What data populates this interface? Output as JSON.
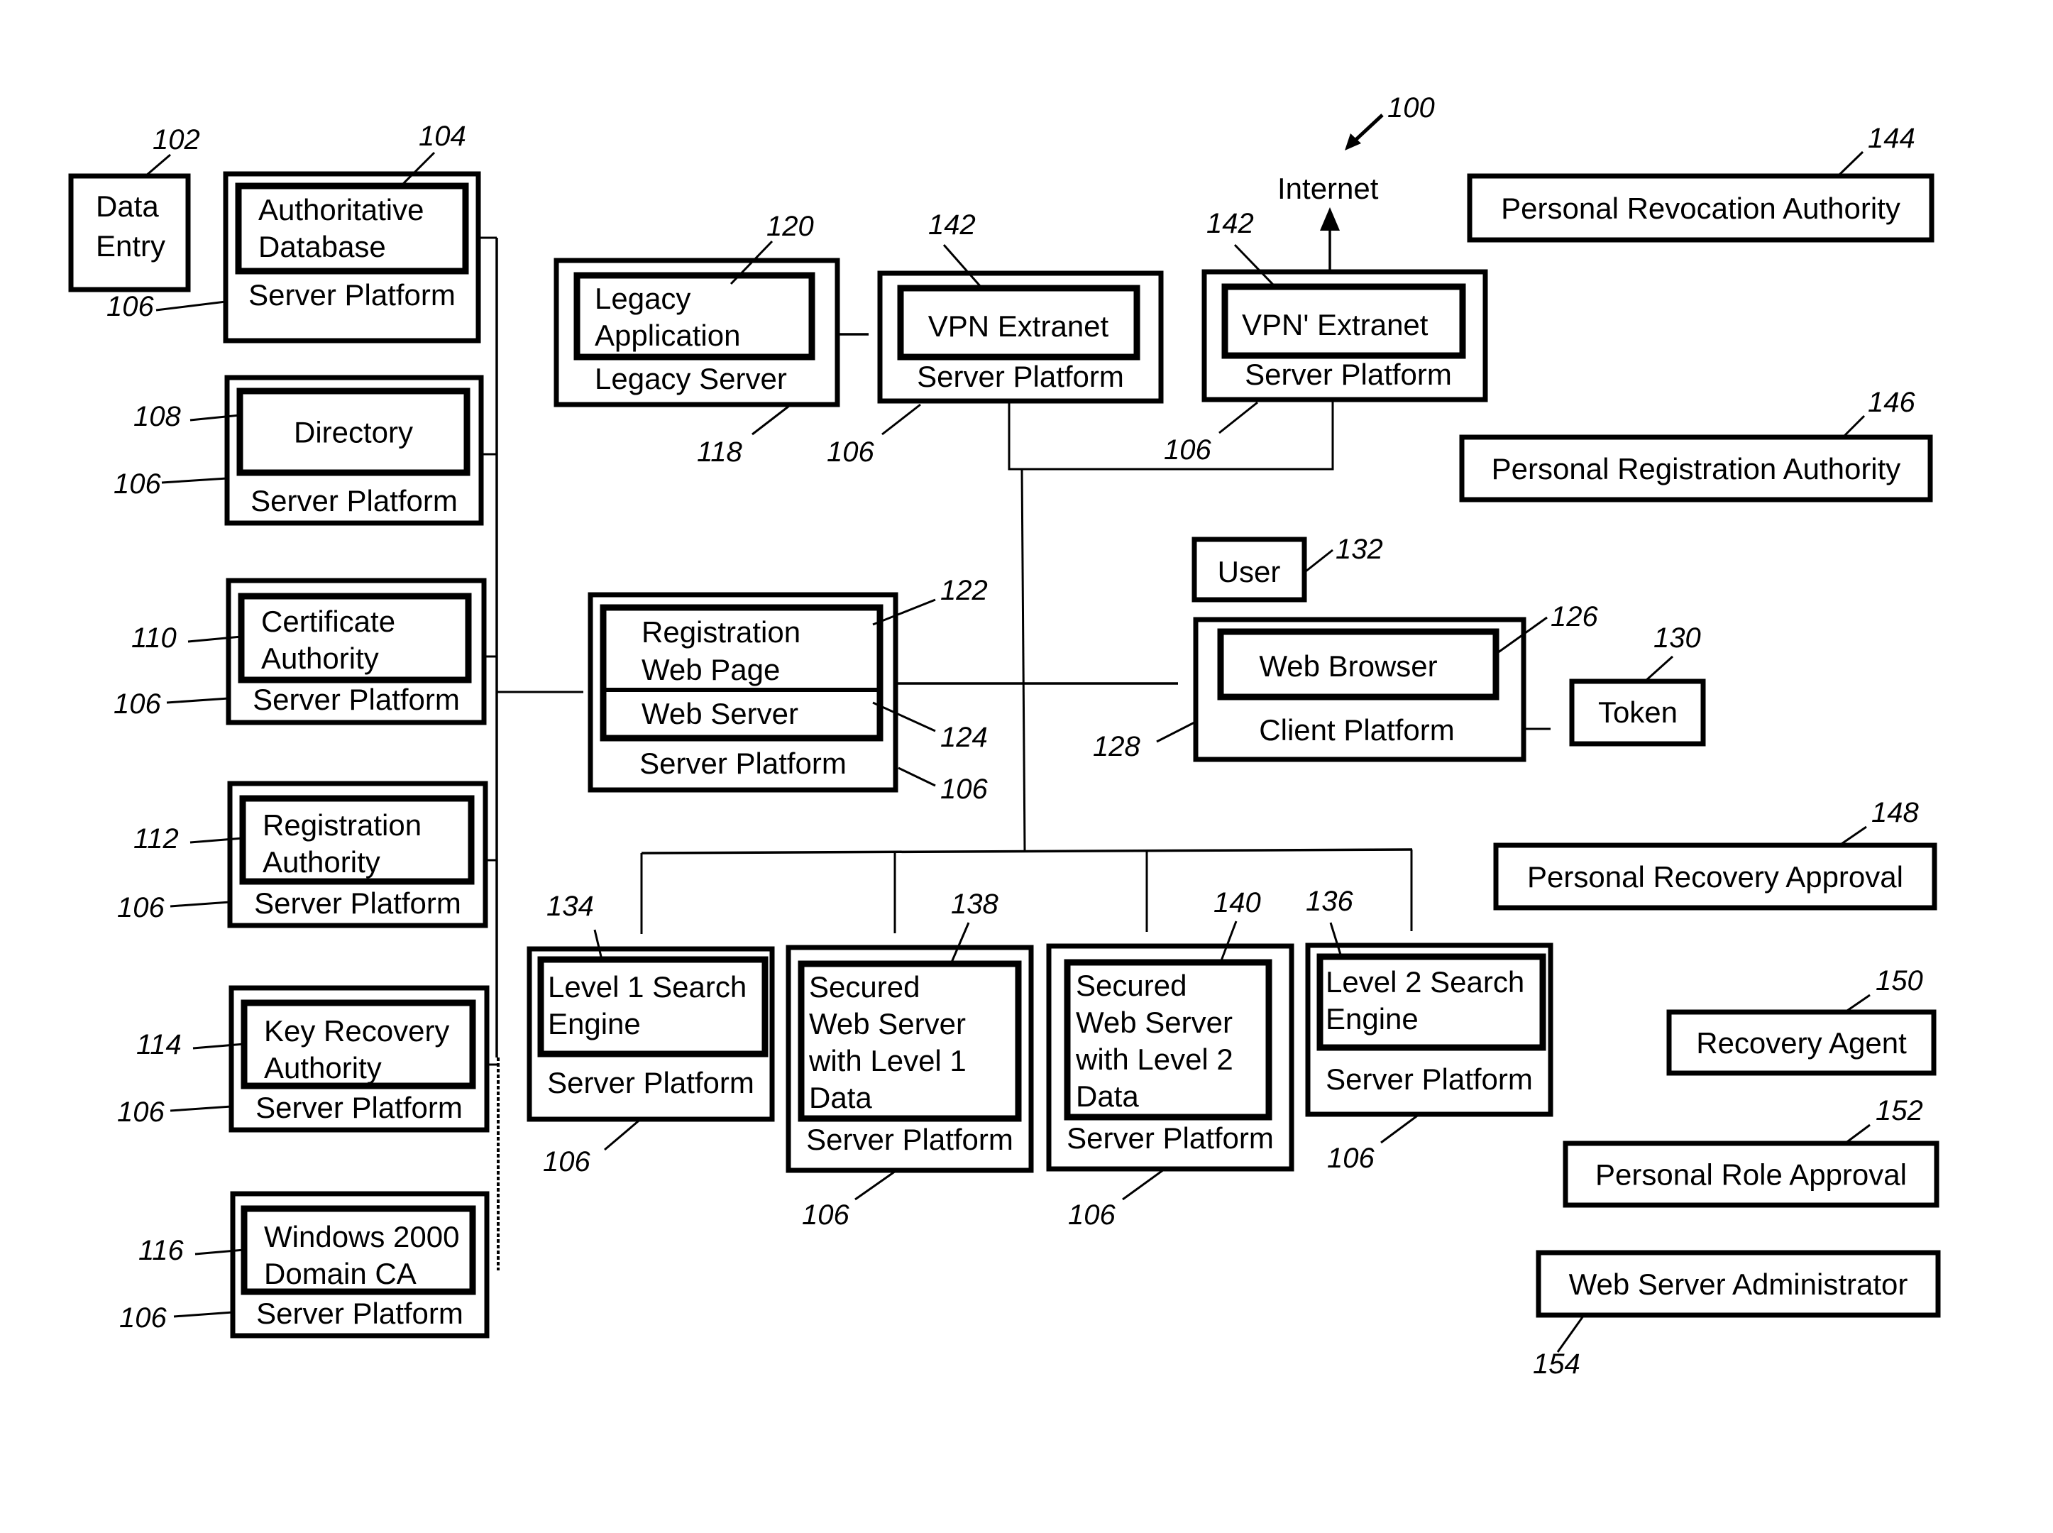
{
  "figure": {
    "ref": "100",
    "internet_label": "Internet"
  },
  "left_column": [
    {
      "id": "data-entry",
      "ref": "102",
      "lines": [
        "Data",
        "Entry"
      ]
    },
    {
      "id": "authoritative-database",
      "ref": "104",
      "platform_ref": "106",
      "lines": [
        "Authoritative",
        "Database"
      ],
      "platform": "Server Platform"
    },
    {
      "id": "directory",
      "ref": "108",
      "platform_ref": "106",
      "lines": [
        "Directory"
      ],
      "platform": "Server Platform"
    },
    {
      "id": "certificate-authority",
      "ref": "110",
      "platform_ref": "106",
      "lines": [
        "Certificate",
        "Authority"
      ],
      "platform": "Server Platform"
    },
    {
      "id": "registration-authority",
      "ref": "112",
      "platform_ref": "106",
      "lines": [
        "Registration",
        "Authority"
      ],
      "platform": "Server Platform"
    },
    {
      "id": "key-recovery-authority",
      "ref": "114",
      "platform_ref": "106",
      "lines": [
        "Key Recovery",
        "Authority"
      ],
      "platform": "Server Platform"
    },
    {
      "id": "windows-2000-domain-ca",
      "ref": "116",
      "platform_ref": "106",
      "lines": [
        "Windows 2000",
        "Domain CA"
      ],
      "platform": "Server Platform"
    }
  ],
  "top_row": [
    {
      "id": "legacy-application",
      "ref": "120",
      "platform_ref": "118",
      "lines": [
        "Legacy",
        "Application"
      ],
      "platform": "Legacy Server"
    },
    {
      "id": "vpn-extranet-1",
      "ref": "142",
      "platform_ref": "106",
      "lines": [
        "VPN Extranet"
      ],
      "platform": "Server Platform"
    },
    {
      "id": "vpn-extranet-2",
      "ref": "142",
      "platform_ref": "106",
      "lines": [
        "VPN' Extranet"
      ],
      "platform": "Server Platform"
    }
  ],
  "registration": {
    "web_page_ref": "122",
    "web_server_ref": "124",
    "platform_ref": "106",
    "web_page_lines": [
      "Registration",
      "Web Page"
    ],
    "web_server": "Web Server",
    "platform": "Server Platform"
  },
  "client": {
    "user": "User",
    "user_ref": "132",
    "browser": "Web Browser",
    "browser_ref": "126",
    "platform": "Client Platform",
    "platform_ref": "128",
    "token": "Token",
    "token_ref": "130"
  },
  "bottom_row": [
    {
      "id": "level-1-search-engine",
      "ref": "134",
      "platform_ref": "106",
      "lines": [
        "Level 1 Search",
        "Engine"
      ],
      "platform": "Server Platform"
    },
    {
      "id": "secured-web-server-level-1",
      "ref": "138",
      "platform_ref": "106",
      "lines": [
        "Secured",
        "Web Server",
        "with Level 1",
        "Data"
      ],
      "platform": "Server Platform"
    },
    {
      "id": "secured-web-server-level-2",
      "ref": "140",
      "platform_ref": "106",
      "lines": [
        "Secured",
        "Web Server",
        "with Level 2",
        "Data"
      ],
      "platform": "Server Platform"
    },
    {
      "id": "level-2-search-engine",
      "ref": "136",
      "platform_ref": "106",
      "lines": [
        "Level 2 Search",
        "Engine"
      ],
      "platform": "Server Platform"
    }
  ],
  "right_column": [
    {
      "id": "personal-revocation-authority",
      "ref": "144",
      "label": "Personal Revocation Authority"
    },
    {
      "id": "personal-registration-authority",
      "ref": "146",
      "label": "Personal Registration Authority"
    },
    {
      "id": "personal-recovery-approval",
      "ref": "148",
      "label": "Personal Recovery Approval"
    },
    {
      "id": "recovery-agent",
      "ref": "150",
      "label": "Recovery Agent"
    },
    {
      "id": "personal-role-approval",
      "ref": "152",
      "label": "Personal Role Approval"
    },
    {
      "id": "web-server-administrator",
      "ref": "154",
      "label": "Web Server Administrator"
    }
  ]
}
